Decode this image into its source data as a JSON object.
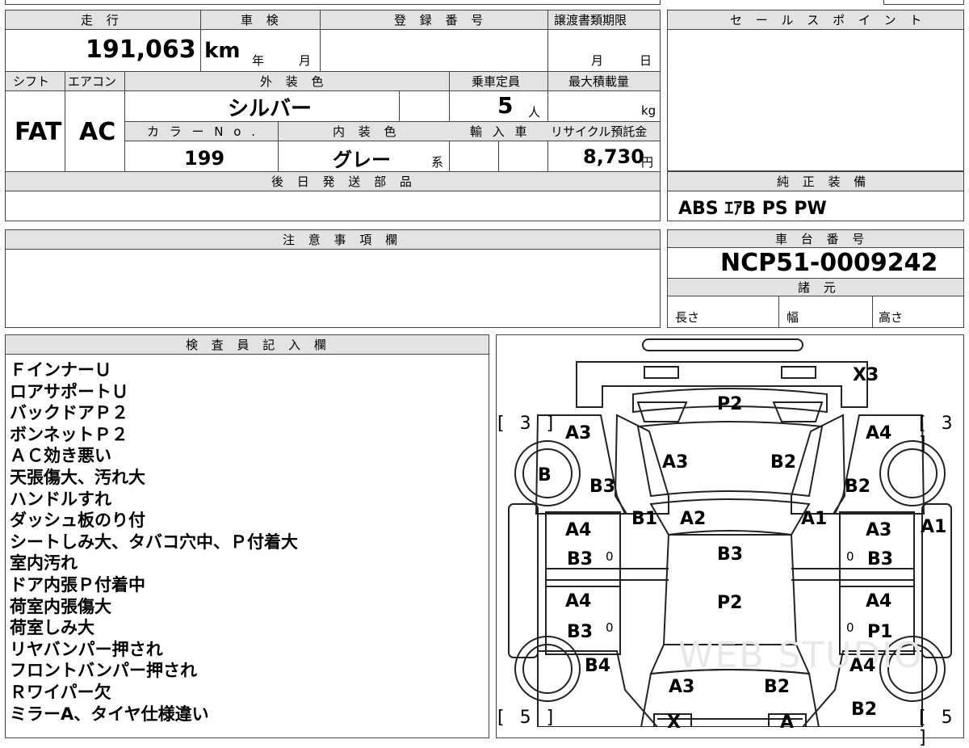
{
  "top": {
    "mileage_label": "走 行",
    "mileage_value": "191,063",
    "mileage_unit": "km",
    "shaken_label": "車 検",
    "shaken_year": "年",
    "shaken_month": "月",
    "reg_label": "登 録 番 号",
    "transfer_label": "譲渡書類期限",
    "transfer_month": "月",
    "transfer_day": "日",
    "shift_label": "シフト",
    "shift_value": "FAT",
    "ac_label": "エアコン",
    "ac_value": "AC",
    "exterior_label": "外 装 色",
    "exterior_value": "シルバー",
    "capacity_label": "乗車定員",
    "capacity_value": "5",
    "capacity_unit": "人",
    "load_label": "最大積載量",
    "load_unit": "kg",
    "color_no_label": "カ ラ ー N o .",
    "color_no_value": "199",
    "interior_label": "内 装 色",
    "interior_value": "グレー",
    "interior_suffix": "系",
    "import_label": "輸 入 車",
    "recycle_label": "リサイクル預託金",
    "recycle_value": "8,730",
    "recycle_unit": "円",
    "later_parts_label": "後 日 発 送 部 品"
  },
  "sales_point": {
    "label": "セ ー ル ス ポ イ ン ト"
  },
  "equipment": {
    "label": "純 正 装 備",
    "value": "ABS ｴｱB PS PW"
  },
  "caution": {
    "label": "注 意 事 項 欄"
  },
  "chassis": {
    "label": "車 台 番 号",
    "value": "NCP51-0009242"
  },
  "specs": {
    "label": "諸 元",
    "length": "長さ",
    "width": "幅",
    "height": "高さ"
  },
  "inspector": {
    "label": "検 査 員 記 入 欄",
    "lines": [
      "ＦインナーＵ",
      "ロアサポートＵ",
      "バックドアＰ２",
      "ボンネットＰ２",
      "ＡＣ効き悪い",
      "天張傷大、汚れ大",
      "ハンドルすれ",
      "ダッシュ板のり付",
      "シートしみ大、タバコ穴中、Ｐ付着大",
      "室内汚れ",
      "ドア内張Ｐ付着中",
      "荷室内張傷大",
      "荷室しみ大",
      "リヤバンパー押され",
      "フロントバンパー押され",
      "Ｒワイパー欠",
      "ミラーA、タイヤ仕様違い"
    ]
  },
  "map": {
    "watermark": "WEB STUDIO",
    "labels": {
      "x3": "X3",
      "p2_top": "P2",
      "tl_bracket": "[ 3 ]",
      "tr_bracket": "[ 3 ]",
      "a3_tl": "A3",
      "a4_tr": "A4",
      "a3_hood": "A3",
      "b2_hood": "B2",
      "b_wheel": "B",
      "b3_l": "B3",
      "b2_r": "B2",
      "b1": "B1",
      "a2": "A2",
      "a1": "A1",
      "a1_side": "A1",
      "a4_ld1": "A4",
      "b3_ld1": "B3",
      "b3_roof": "B3",
      "a3_rd1": "A3",
      "b3_rd1": "B3",
      "p2_roof": "P2",
      "a4_ld2": "A4",
      "b3_ld2": "B3",
      "a4_rd2": "A4",
      "p1_rd2": "P1",
      "b4": "B4",
      "a4_br": "A4",
      "a3_trunk": "A3",
      "b2_trunk": "B2",
      "b2_br": "B2",
      "bl_bracket": "[ 5 ]",
      "br_bracket": "[ 5 ]",
      "x_bot": "X",
      "a_bot": "A",
      "zero": "0"
    }
  }
}
